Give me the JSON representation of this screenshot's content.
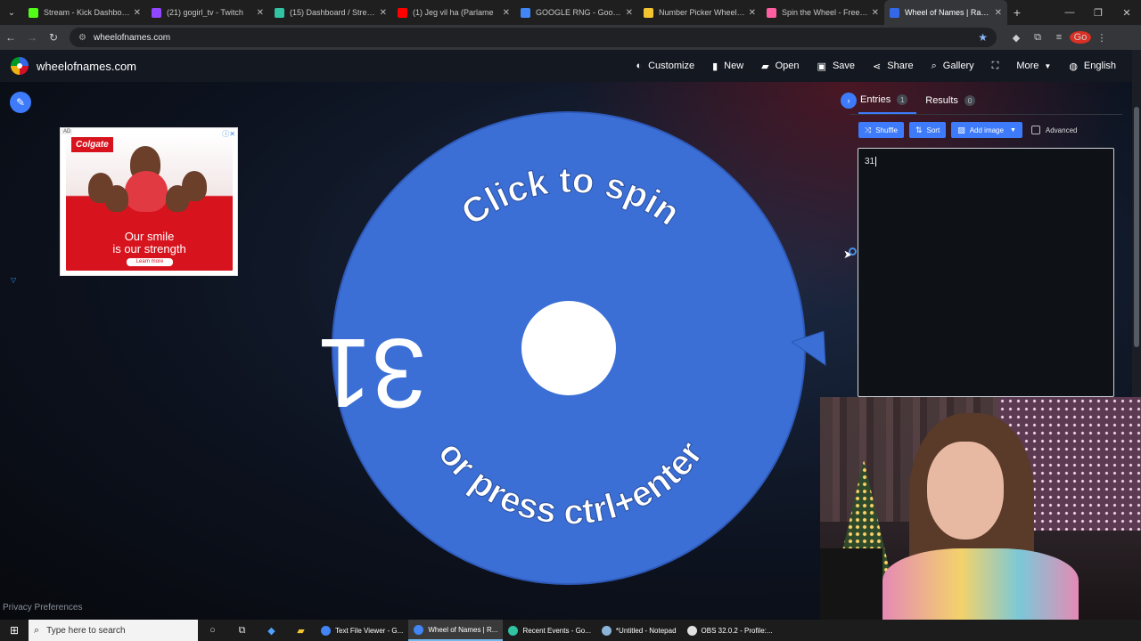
{
  "browser": {
    "tabs": [
      {
        "title": "Stream - Kick Dashboard",
        "color": "#53fc18",
        "active": false
      },
      {
        "title": "(21) gogirl_tv - Twitch",
        "color": "#9146ff",
        "active": false
      },
      {
        "title": "(15) Dashboard / Streamlabs",
        "color": "#31c3a2",
        "active": false
      },
      {
        "title": "(1) Jeg vil ha (Parlame",
        "color": "#ff0000",
        "active": false
      },
      {
        "title": "GOOGLE RNG - Google Se",
        "color": "#4285f4",
        "active": false
      },
      {
        "title": "Number Picker Wheel - P",
        "color": "#f4c430",
        "active": false
      },
      {
        "title": "Spin the Wheel - Free and",
        "color": "#ff5fa2",
        "active": false
      },
      {
        "title": "Wheel of Names | Random",
        "color": "#3369e8",
        "active": true
      }
    ],
    "url": "wheelofnames.com",
    "profile_initials": "Go"
  },
  "site": {
    "name": "wheelofnames.com",
    "nav": [
      {
        "label": "Customize",
        "icon": "palette-icon",
        "glyph": "◐"
      },
      {
        "label": "New",
        "icon": "file-icon",
        "glyph": "▮"
      },
      {
        "label": "Open",
        "icon": "folder-icon",
        "glyph": "▰"
      },
      {
        "label": "Save",
        "icon": "save-icon",
        "glyph": "▣"
      },
      {
        "label": "Share",
        "icon": "share-icon",
        "glyph": "⋖"
      },
      {
        "label": "Gallery",
        "icon": "search-icon",
        "glyph": "⌕"
      }
    ],
    "more_label": "More",
    "language_label": "English"
  },
  "ad": {
    "badge": "AD",
    "brand": "Colgate",
    "line1": "Our smile",
    "line2": "is our strength",
    "cta": "Learn more"
  },
  "wheel": {
    "color": "#3b6fd6",
    "entry_label": "31",
    "top_text": "Click to spin",
    "bottom_text": "or press ctrl+enter"
  },
  "panel": {
    "tabs": [
      {
        "label": "Entries",
        "count": "1"
      },
      {
        "label": "Results",
        "count": "0"
      }
    ],
    "buttons": {
      "shuffle": "Shuffle",
      "sort": "Sort",
      "add_image": "Add image"
    },
    "advanced_label": "Advanced",
    "entries_text": "31"
  },
  "privacy_label": "Privacy Preferences",
  "taskbar": {
    "search_placeholder": "Type here to search",
    "apps": [
      {
        "label": "Text File Viewer - G...",
        "color": "#4285f4",
        "active": false
      },
      {
        "label": "Wheel of Names | R...",
        "color": "#4285f4",
        "active": true
      },
      {
        "label": "Recent Events - Go...",
        "color": "#31c3a2",
        "active": false
      },
      {
        "label": "*Untitled - Notepad",
        "color": "#8ab4d8",
        "active": false
      },
      {
        "label": "OBS 32.0.2 - Profile:...",
        "color": "#e0e0e0",
        "active": false
      }
    ]
  },
  "colors": {
    "accent": "#3e7bfa",
    "navbar": "#141821"
  }
}
